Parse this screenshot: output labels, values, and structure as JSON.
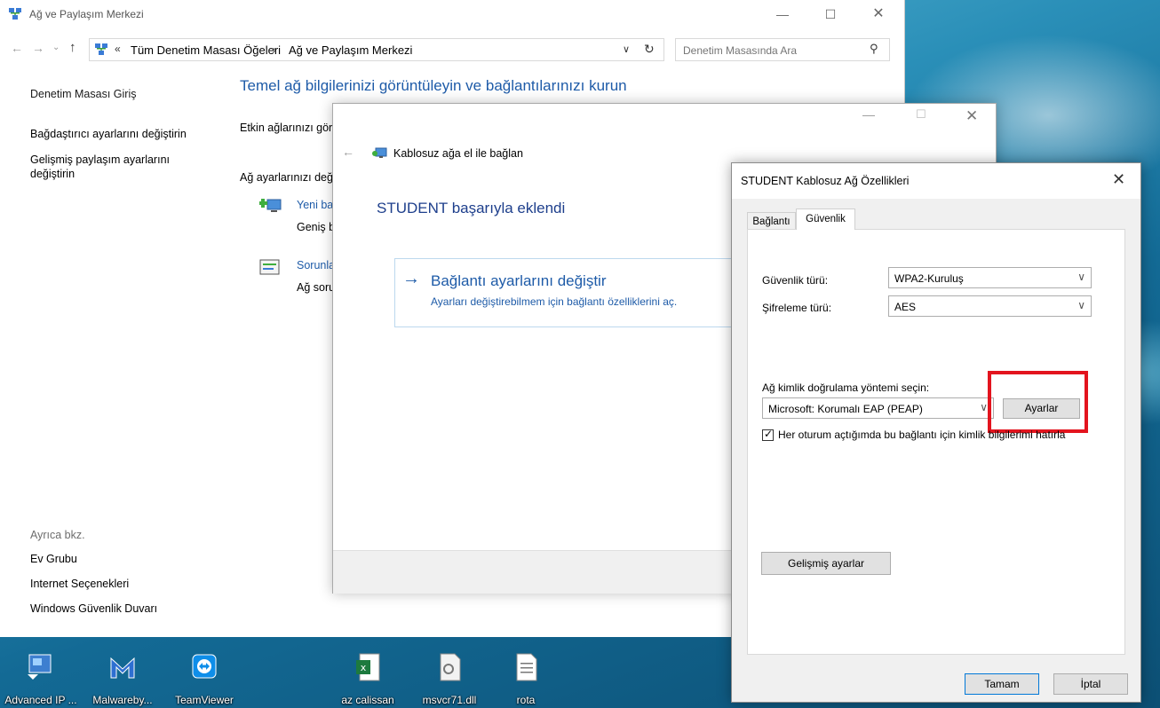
{
  "cp_window": {
    "title": "Ağ ve Paylaşım Merkezi",
    "controls": {
      "minimize": "—",
      "maximize": "☐",
      "close": "✕"
    }
  },
  "address": {
    "chevron": "«",
    "crumb1": "Tüm Denetim Masası Öğeleri",
    "separator": "›",
    "crumb2": "Ağ ve Paylaşım Merkezi",
    "search_placeholder": "Denetim Masasında Ara"
  },
  "sidebar": {
    "home": "Denetim Masası Giriş",
    "adapter": "Bağdaştırıcı ayarlarını değiştirin",
    "sharing": "Gelişmiş paylaşım ayarlarını değiştirin",
    "see_also": "Ayrıca bkz.",
    "homegroup": "Ev Grubu",
    "internet_options": "Internet Seçenekleri",
    "firewall": "Windows Güvenlik Duvarı"
  },
  "main": {
    "heading": "Temel ağ bilgilerinizi görüntüleyin ve bağlantılarınızı kurun",
    "active_networks": "Etkin ağlarınızı görüntüleyin",
    "change_settings": "Ağ ayarlarınızı değiştirin",
    "new_connection_link": "Yeni bağlantı veya ağ kurun",
    "new_connection_desc": "Geniş bant, çevirmeli veya VPN bağlantısı kurun",
    "troubleshoot_link": "Sorunları giderin",
    "troubleshoot_desc": "Ağ sorunlarını tanılayın ve onarın"
  },
  "wizard": {
    "title": "Kablosuz ağa el ile bağlan",
    "heading": "STUDENT başarıyla eklendi",
    "option_title": "Bağlantı ayarlarını değiştir",
    "option_desc": "Ayarları değiştirebilmem için bağlantı özelliklerini aç."
  },
  "props": {
    "title": "STUDENT Kablosuz Ağ Özellikleri",
    "tabs": {
      "connection": "Bağlantı",
      "security": "Güvenlik"
    },
    "security_type_label": "Güvenlik türü:",
    "security_type_value": "WPA2-Kuruluş",
    "encryption_type_label": "Şifreleme türü:",
    "encryption_type_value": "AES",
    "auth_method_label": "Ağ kimlik doğrulama yöntemi seçin:",
    "auth_method_value": "Microsoft: Korumalı EAP (PEAP)",
    "settings_button": "Ayarlar",
    "remember_label": "Her oturum açtığımda bu bağlantı için kimlik bilgilerimi hatırla",
    "remember_checked": true,
    "advanced_button": "Gelişmiş ayarlar",
    "ok_button": "Tamam",
    "cancel_button": "İptal",
    "highlight_color": "#e3141e"
  },
  "desktop_icons": [
    {
      "label": "Advanced IP ...",
      "icon": "advanced-ip-scanner-icon"
    },
    {
      "label": "Malwareby...",
      "icon": "malwarebytes-icon"
    },
    {
      "label": "TeamViewer",
      "icon": "teamviewer-icon"
    },
    {
      "label": "az calissan",
      "icon": "excel-file-icon"
    },
    {
      "label": "msvcr71.dll",
      "icon": "dll-file-icon"
    },
    {
      "label": "rota",
      "icon": "text-file-icon"
    }
  ]
}
